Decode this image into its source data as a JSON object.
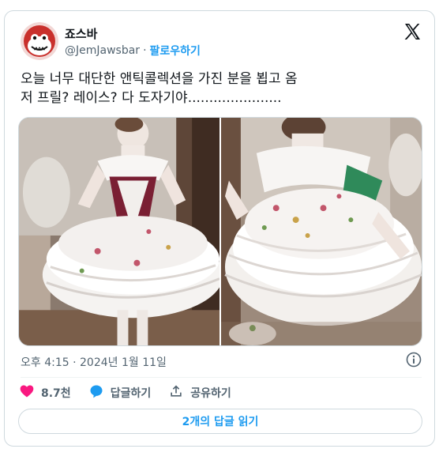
{
  "author": {
    "display_name": "죠스바",
    "handle": "@JemJawsbar",
    "separator": "·",
    "follow_label": "팔로우하기"
  },
  "tweet": {
    "text": "오늘 너무 대단한 앤틱콜렉션을 가진 분을 뵙고 옴\n저 프릴? 레이스? 다 도자기야......................",
    "timestamp": "오후 4:15 · 2024년 1월 11일"
  },
  "actions": {
    "like_count": "8.7천",
    "reply_label": "답글하기",
    "share_label": "공유하기"
  },
  "replies_button": "2개의 답글 읽기",
  "colors": {
    "accent": "#1d9bf0",
    "like": "#f91880",
    "text_secondary": "#536471",
    "border": "#cfd9de"
  },
  "icons": {
    "logo": "x-logo-icon",
    "like": "heart-icon",
    "reply": "speech-bubble-icon",
    "share": "share-upload-icon",
    "info": "info-icon"
  }
}
